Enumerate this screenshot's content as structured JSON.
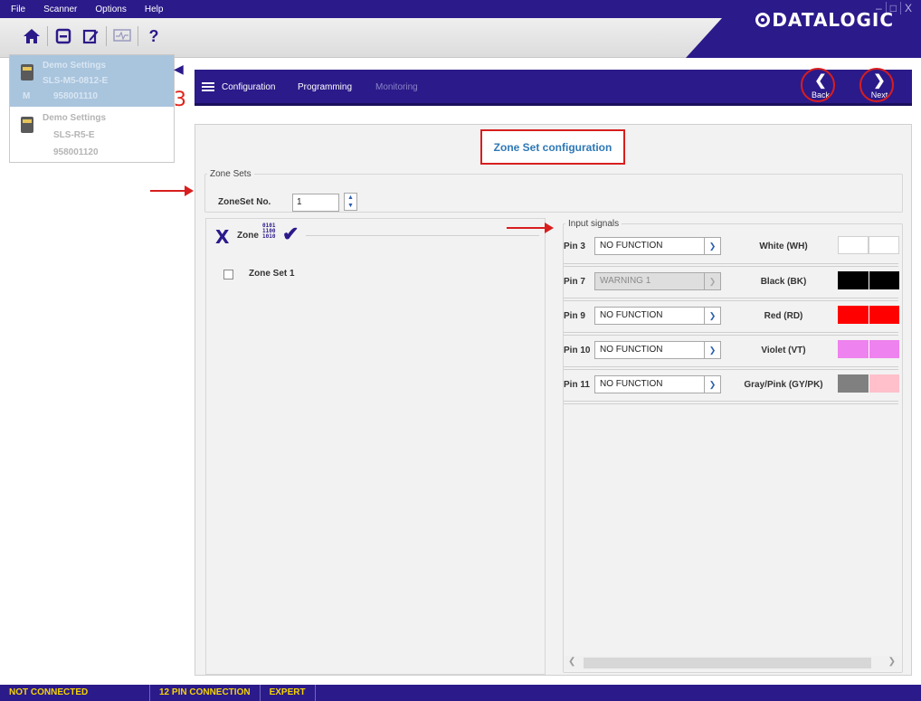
{
  "menu": {
    "items": [
      "File",
      "Scanner",
      "Options",
      "Help"
    ]
  },
  "window_controls": {
    "minimize": "–",
    "maximize": "□",
    "close": "X"
  },
  "toolbar": {
    "icons": [
      "home-icon",
      "save-icon",
      "edit-icon",
      "monitor-icon",
      "help-icon"
    ],
    "help_glyph": "?"
  },
  "brand": {
    "logo_text": "DATALOGIC"
  },
  "devices": [
    {
      "name": "Demo Settings",
      "model": "SLS-M5-0812-E",
      "tag": "M",
      "serial": "958001110",
      "selected": true
    },
    {
      "name": "Demo Settings",
      "model": "SLS-R5-E",
      "tag": "",
      "serial": "958001120",
      "selected": false
    }
  ],
  "annotation": {
    "step_number": "3"
  },
  "nav": {
    "tabs": [
      {
        "label": "Configuration",
        "active": true
      },
      {
        "label": "Programming",
        "active": true
      },
      {
        "label": "Monitoring",
        "active": false
      }
    ],
    "back_label": "Back",
    "next_label": "Next"
  },
  "page": {
    "title": "Zone Set configuration"
  },
  "zone_sets": {
    "legend": "Zone Sets",
    "number_label": "ZoneSet No.",
    "number_value": "1"
  },
  "zone_panel": {
    "header_label": "Zone",
    "binary_glyph": "0101\n1100\n1010",
    "items": [
      {
        "label": "Zone Set 1",
        "checked": false
      }
    ]
  },
  "input_signals": {
    "legend": "Input signals",
    "pins": [
      {
        "pin": "Pin 3",
        "function": "NO FUNCTION",
        "enabled": true,
        "wire": "White (WH)",
        "colors": [
          "#ffffff",
          "#ffffff"
        ]
      },
      {
        "pin": "Pin 7",
        "function": "WARNING 1",
        "enabled": false,
        "wire": "Black (BK)",
        "colors": [
          "#000000",
          "#000000"
        ]
      },
      {
        "pin": "Pin 9",
        "function": "NO FUNCTION",
        "enabled": true,
        "wire": "Red (RD)",
        "colors": [
          "#ff0000",
          "#ff0000"
        ]
      },
      {
        "pin": "Pin 10",
        "function": "NO FUNCTION",
        "enabled": true,
        "wire": "Violet (VT)",
        "colors": [
          "#ee82ee",
          "#ee82ee"
        ]
      },
      {
        "pin": "Pin 11",
        "function": "NO FUNCTION",
        "enabled": true,
        "wire": "Gray/Pink (GY/PK)",
        "colors": [
          "#808080",
          "#ffc0cb"
        ]
      }
    ]
  },
  "status": {
    "items": [
      "NOT CONNECTED",
      "12 PIN CONNECTION",
      "EXPERT"
    ]
  },
  "colors": {
    "brand": "#2b1a8a",
    "annotation_red": "#d81e1e",
    "status_text": "#f5d400",
    "title_blue": "#2e78b5"
  }
}
